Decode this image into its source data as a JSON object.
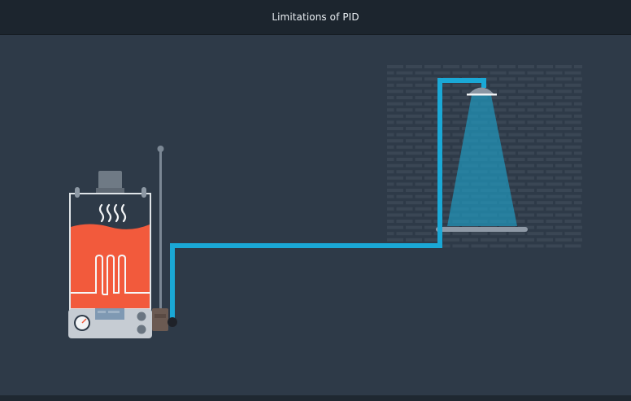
{
  "header": {
    "title": "Limitations of PID"
  },
  "colors": {
    "background": "#2e3a48",
    "topbar": "#1c252e",
    "pipe": "#1aa8d6",
    "water_tank": "#f25a3c",
    "brick": "#3a4654",
    "shower_beam": "#1e9fc7"
  },
  "scene": {
    "objects": [
      "water-heater",
      "temperature-probe",
      "water-pipe",
      "brick-wall",
      "shower-head",
      "shower-water",
      "shower-tray"
    ]
  }
}
